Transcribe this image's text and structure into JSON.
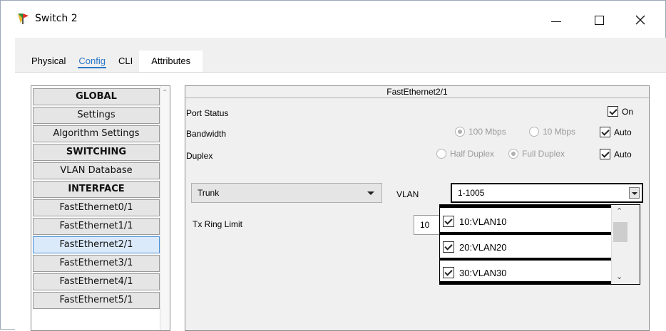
{
  "window": {
    "title": "Switch 2",
    "controls": {
      "minimize": "—",
      "maximize": "☐",
      "close": "✕"
    }
  },
  "tabs": [
    {
      "label": "Physical",
      "active": false
    },
    {
      "label": "Config",
      "active": true
    },
    {
      "label": "CLI",
      "active": false
    },
    {
      "label": "Attributes",
      "active": false
    }
  ],
  "nav": {
    "items": [
      {
        "label": "GLOBAL",
        "type": "header"
      },
      {
        "label": "Settings",
        "type": "item"
      },
      {
        "label": "Algorithm Settings",
        "type": "item"
      },
      {
        "label": "SWITCHING",
        "type": "header"
      },
      {
        "label": "VLAN Database",
        "type": "item"
      },
      {
        "label": "INTERFACE",
        "type": "header"
      },
      {
        "label": "FastEthernet0/1",
        "type": "item"
      },
      {
        "label": "FastEthernet1/1",
        "type": "item"
      },
      {
        "label": "FastEthernet2/1",
        "type": "item",
        "selected": true
      },
      {
        "label": "FastEthernet3/1",
        "type": "item"
      },
      {
        "label": "FastEthernet4/1",
        "type": "item"
      },
      {
        "label": "FastEthernet5/1",
        "type": "item"
      }
    ]
  },
  "panel": {
    "title": "FastEthernet2/1",
    "port_status": {
      "label": "Port Status",
      "on_label": "On",
      "on_checked": true
    },
    "bandwidth": {
      "label": "Bandwidth",
      "opt1": "100 Mbps",
      "opt2": "10 Mbps",
      "auto_label": "Auto",
      "auto_checked": true,
      "selected": "100 Mbps"
    },
    "duplex": {
      "label": "Duplex",
      "opt1": "Half Duplex",
      "opt2": "Full Duplex",
      "auto_label": "Auto",
      "auto_checked": true,
      "selected": "Full Duplex"
    },
    "mode": {
      "value": "Trunk"
    },
    "vlan": {
      "label": "VLAN",
      "value": "1-1005",
      "options": [
        {
          "label": "10:VLAN10",
          "checked": true
        },
        {
          "label": "20:VLAN20",
          "checked": true
        },
        {
          "label": "30:VLAN30",
          "checked": true
        }
      ]
    },
    "tx_ring_limit": {
      "label": "Tx Ring Limit",
      "value": "10"
    }
  }
}
